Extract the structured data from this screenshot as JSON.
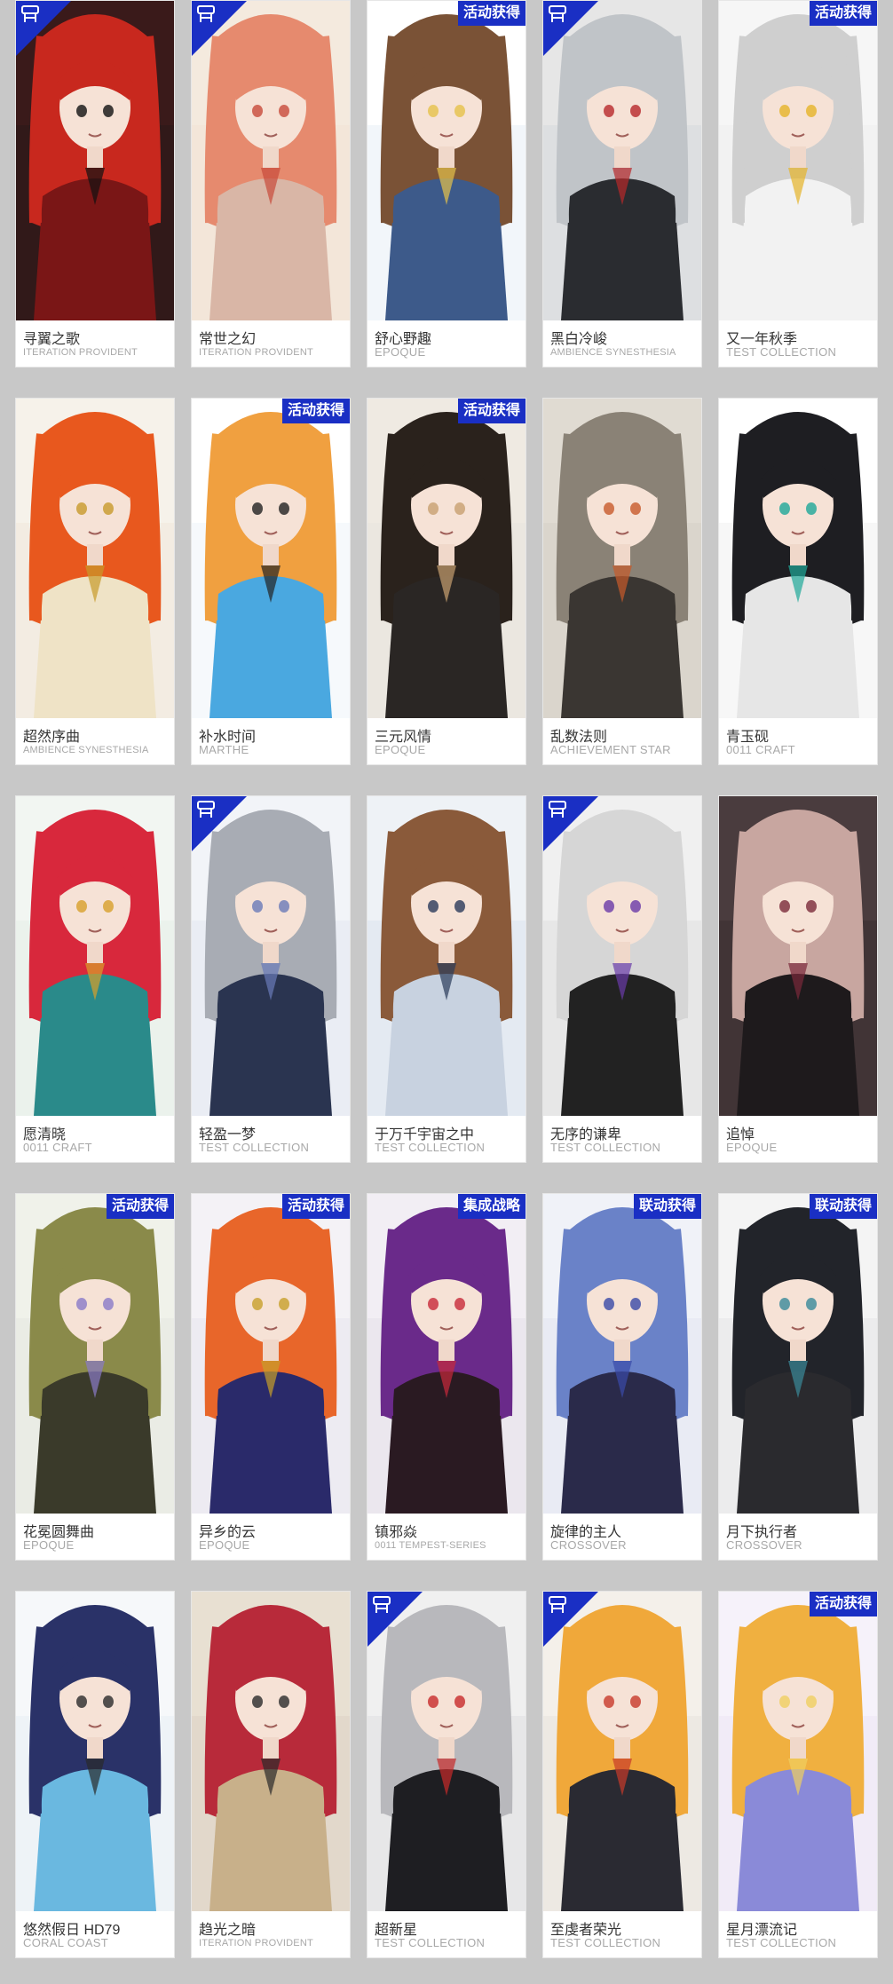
{
  "colors": {
    "page_background": "#c8c8c8",
    "badge_blue": "#1a2fc4",
    "name_text": "#333333",
    "series_text": "#a8a8a8"
  },
  "cards": [
    {
      "name": "寻翼之歌",
      "series": "ITERATION PROVIDENT",
      "badge": "",
      "corner": true,
      "hair": "#c8281e",
      "bg": "#2a1a1a",
      "top": "#3a1a1a",
      "outfit": "#7a1616",
      "accent": "#111111"
    },
    {
      "name": "常世之幻",
      "series": "ITERATION PROVIDENT",
      "badge": "",
      "corner": true,
      "hair": "#e68a6e",
      "bg": "#f2e2d6",
      "top": "#f4eade",
      "outfit": "#d9b6a6",
      "accent": "#c84a3a"
    },
    {
      "name": "舒心野趣",
      "series": "EPOQUE",
      "badge": "活动获得",
      "corner": false,
      "hair": "#7a5236",
      "bg": "#e8eef6",
      "top": "#ffffff",
      "outfit": "#3d5a8a",
      "accent": "#e6c24a"
    },
    {
      "name": "黑白冷峻",
      "series": "AMBIENCE SYNESTHESIA",
      "badge": "",
      "corner": true,
      "hair": "#c0c4c8",
      "bg": "#d6d8dc",
      "top": "#e6e6e6",
      "outfit": "#2a2c30",
      "accent": "#b8282a"
    },
    {
      "name": "又一年秋季",
      "series": "TEST COLLECTION",
      "badge": "活动获得",
      "corner": false,
      "hair": "#cfcfcf",
      "bg": "#eeeeee",
      "top": "#f6f6f6",
      "outfit": "#f2f2f2",
      "accent": "#e6b428"
    },
    {
      "name": "超然序曲",
      "series": "AMBIENCE SYNESTHESIA",
      "badge": "",
      "corner": false,
      "hair": "#e8581e",
      "bg": "#f0e8da",
      "top": "#f6f2ea",
      "outfit": "#efe3c6",
      "accent": "#c89a2a"
    },
    {
      "name": "补水时间",
      "series": "MARTHE",
      "badge": "活动获得",
      "corner": false,
      "hair": "#f0a040",
      "bg": "#eef4fa",
      "top": "#ffffff",
      "outfit": "#4aa8e0",
      "accent": "#222222"
    },
    {
      "name": "三元风情",
      "series": "EPOQUE",
      "badge": "活动获得",
      "corner": false,
      "hair": "#2a221c",
      "bg": "#e8e4de",
      "top": "#efeae2",
      "outfit": "#2a2624",
      "accent": "#c8a070"
    },
    {
      "name": "乱数法则",
      "series": "ACHIEVEMENT STAR",
      "badge": "",
      "corner": false,
      "hair": "#8a8276",
      "bg": "#d6d0c6",
      "top": "#e0dbd2",
      "outfit": "#3a3632",
      "accent": "#c85a2a"
    },
    {
      "name": "青玉砚",
      "series": "0011 CRAFT",
      "badge": "",
      "corner": false,
      "hair": "#1e1e22",
      "bg": "#f0f0f0",
      "top": "#ffffff",
      "outfit": "#e6e6e6",
      "accent": "#1ea898"
    },
    {
      "name": "愿清晓",
      "series": "0011 CRAFT",
      "badge": "",
      "corner": false,
      "hair": "#d8283c",
      "bg": "#e6eee8",
      "top": "#f2f6f2",
      "outfit": "#2a8a8a",
      "accent": "#d8a02a"
    },
    {
      "name": "轻盈一梦",
      "series": "TEST COLLECTION",
      "badge": "",
      "corner": true,
      "hair": "#a8acb4",
      "bg": "#e4e8f0",
      "top": "#f2f4f8",
      "outfit": "#2a3450",
      "accent": "#6a7ab8"
    },
    {
      "name": "于万千宇宙之中",
      "series": "TEST COLLECTION",
      "badge": "",
      "corner": false,
      "hair": "#8a5a3a",
      "bg": "#dce4ee",
      "top": "#eef2f6",
      "outfit": "#c8d2e0",
      "accent": "#2a3a5a"
    },
    {
      "name": "无序的谦卑",
      "series": "TEST COLLECTION",
      "badge": "",
      "corner": true,
      "hair": "#d6d6d6",
      "bg": "#e0e0e0",
      "top": "#f0f0f0",
      "outfit": "#222222",
      "accent": "#6a3aa8"
    },
    {
      "name": "追悼",
      "series": "EPOQUE",
      "badge": "",
      "corner": false,
      "hair": "#c8a6a0",
      "bg": "#3a2e30",
      "top": "#4a3c3e",
      "outfit": "#1e1a1c",
      "accent": "#7a2a3a"
    },
    {
      "name": "花冕圆舞曲",
      "series": "EPOQUE",
      "badge": "活动获得",
      "corner": false,
      "hair": "#8a8a4a",
      "bg": "#e6e8e0",
      "top": "#f0f2ea",
      "outfit": "#3a3a2a",
      "accent": "#8a7ac8"
    },
    {
      "name": "异乡的云",
      "series": "EPOQUE",
      "badge": "活动获得",
      "corner": false,
      "hair": "#e8662a",
      "bg": "#e8e6ee",
      "top": "#f4f2f6",
      "outfit": "#2a2a6a",
      "accent": "#c8a02a"
    },
    {
      "name": "镇邪焱",
      "series": "0011 TEMPEST-SERIES",
      "badge": "集成战略",
      "corner": false,
      "hair": "#6a2a8a",
      "bg": "#e6e2ea",
      "top": "#f2eef4",
      "outfit": "#2a1a22",
      "accent": "#c82a3a"
    },
    {
      "name": "旋律的主人",
      "series": "CROSSOVER",
      "badge": "联动获得",
      "corner": false,
      "hair": "#6a82c8",
      "bg": "#e4e6f0",
      "top": "#f0f2f8",
      "outfit": "#2a2a4a",
      "accent": "#3a4aa8"
    },
    {
      "name": "月下执行者",
      "series": "CROSSOVER",
      "badge": "联动获得",
      "corner": false,
      "hair": "#22242a",
      "bg": "#e6e6e8",
      "top": "#f4f4f4",
      "outfit": "#2a2a2e",
      "accent": "#3a8a9a"
    },
    {
      "name": "悠然假日 HD79",
      "series": "CORAL COAST",
      "badge": "",
      "corner": false,
      "hair": "#2a3268",
      "bg": "#e8eef4",
      "top": "#f6f8fa",
      "outfit": "#6ab8e0",
      "accent": "#2a2a2a"
    },
    {
      "name": "趋光之暗",
      "series": "ITERATION PROVIDENT",
      "badge": "",
      "corner": false,
      "hair": "#b82a3a",
      "bg": "#dcd2c4",
      "top": "#e8e0d2",
      "outfit": "#c8b08a",
      "accent": "#2a2a2a"
    },
    {
      "name": "超新星",
      "series": "TEST COLLECTION",
      "badge": "",
      "corner": true,
      "hair": "#b8b8bc",
      "bg": "#e0e0e2",
      "top": "#f0f0f0",
      "outfit": "#1e1e22",
      "accent": "#c82a2a"
    },
    {
      "name": "至虔者荣光",
      "series": "TEST COLLECTION",
      "badge": "",
      "corner": true,
      "hair": "#f0a83a",
      "bg": "#e8e4dc",
      "top": "#f4f0ea",
      "outfit": "#2a2a32",
      "accent": "#c83a2a"
    },
    {
      "name": "星月漂流记",
      "series": "TEST COLLECTION",
      "badge": "活动获得",
      "corner": false,
      "hair": "#f0b040",
      "bg": "#ece6f4",
      "top": "#f6f2fa",
      "outfit": "#8a8ad8",
      "accent": "#f0d060"
    }
  ]
}
